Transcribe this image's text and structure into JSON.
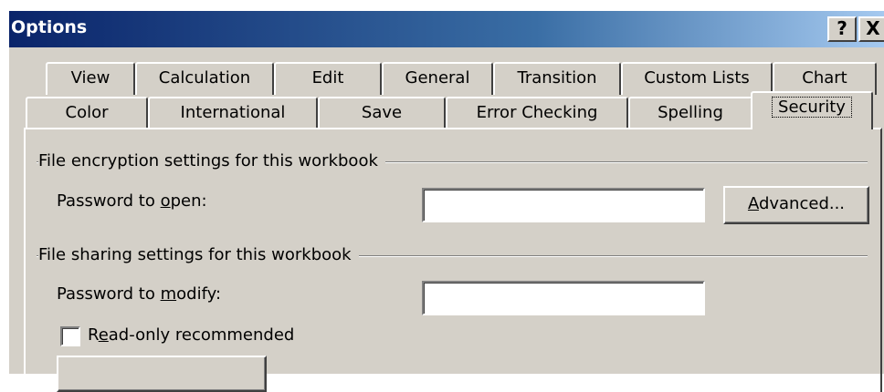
{
  "window": {
    "title": "Options",
    "help_button": "?",
    "close_button": "X"
  },
  "tabs_row1": [
    "View",
    "Calculation",
    "Edit",
    "General",
    "Transition",
    "Custom Lists",
    "Chart"
  ],
  "tabs_row2": [
    "Color",
    "International",
    "Save",
    "Error Checking",
    "Spelling",
    "Security"
  ],
  "active_tab": "Security",
  "encryption": {
    "group_label": "File encryption settings for this workbook",
    "password_open_label": "Password to open:",
    "password_open_value": "",
    "advanced_button": "Advanced..."
  },
  "sharing": {
    "group_label": "File sharing settings for this workbook",
    "password_modify_label": "Password to modify:",
    "password_modify_value": "",
    "readonly_label": "Read-only recommended",
    "readonly_checked": false
  }
}
